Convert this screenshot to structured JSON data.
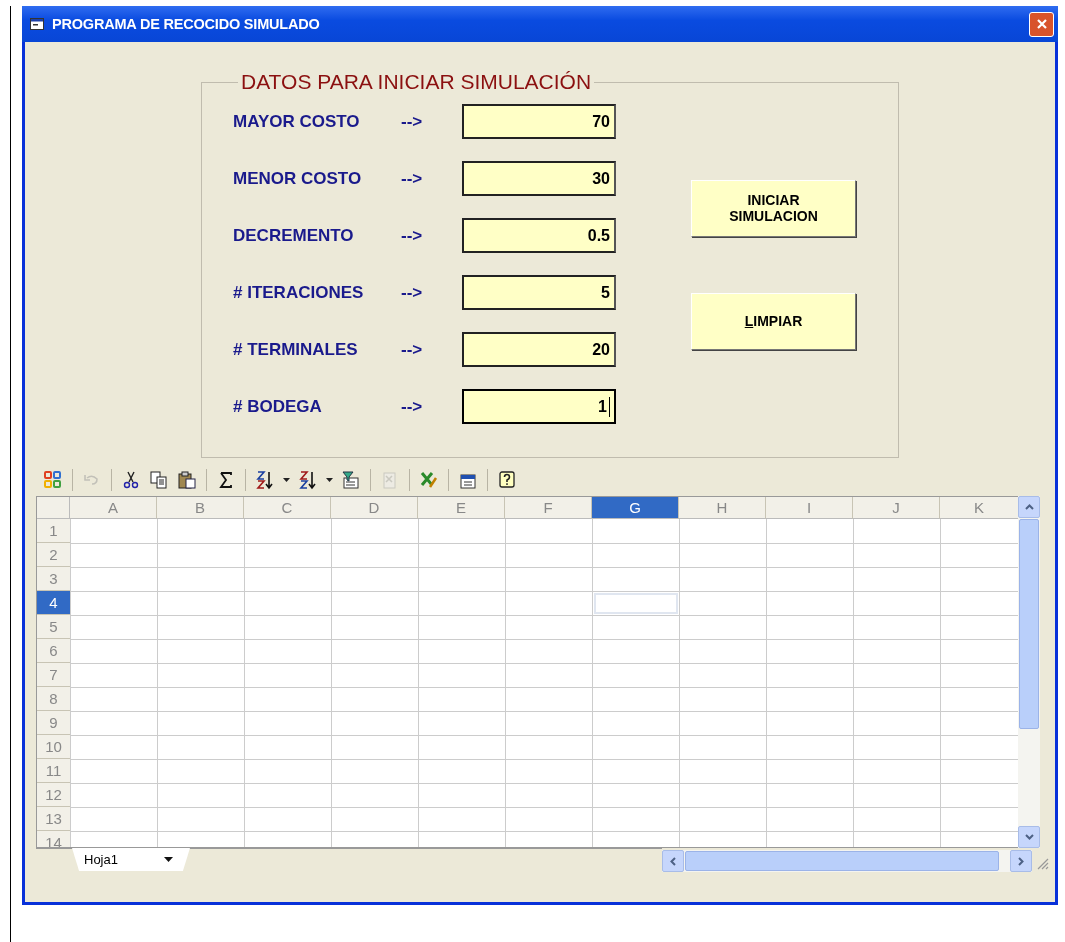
{
  "window": {
    "title": "PROGRAMA DE RECOCIDO SIMULADO"
  },
  "group": {
    "title": "DATOS PARA INICIAR SIMULACIÓN",
    "fields": [
      {
        "label": "MAYOR COSTO",
        "arrow": "-->",
        "value": "70",
        "focused": false
      },
      {
        "label": "MENOR COSTO",
        "arrow": "-->",
        "value": "30",
        "focused": false
      },
      {
        "label": "DECREMENTO",
        "arrow": "-->",
        "value": "0.5",
        "focused": false
      },
      {
        "label": "# ITERACIONES",
        "arrow": "-->",
        "value": "5",
        "focused": false
      },
      {
        "label": "# TERMINALES",
        "arrow": "-->",
        "value": "20",
        "focused": false
      },
      {
        "label": "# BODEGA",
        "arrow": "-->",
        "value": "1",
        "focused": true
      }
    ]
  },
  "buttons": [
    {
      "label": "INICIAR SIMULACION",
      "mnemonic_underlined": false
    },
    {
      "label": "LIMPIAR",
      "mnemonic_underlined": true
    }
  ],
  "toolbar": [
    {
      "kind": "office-logo",
      "disabled": false
    },
    {
      "kind": "separator"
    },
    {
      "kind": "undo",
      "disabled": true
    },
    {
      "kind": "separator"
    },
    {
      "kind": "cut",
      "disabled": false
    },
    {
      "kind": "copy",
      "disabled": false
    },
    {
      "kind": "paste",
      "disabled": false
    },
    {
      "kind": "separator"
    },
    {
      "kind": "sum",
      "disabled": false
    },
    {
      "kind": "separator"
    },
    {
      "kind": "sort-ascending",
      "disabled": false
    },
    {
      "kind": "dropdown"
    },
    {
      "kind": "sort-descending",
      "disabled": false
    },
    {
      "kind": "dropdown"
    },
    {
      "kind": "filter",
      "disabled": false
    },
    {
      "kind": "separator"
    },
    {
      "kind": "properties",
      "disabled": true
    },
    {
      "kind": "separator"
    },
    {
      "kind": "export",
      "disabled": false
    },
    {
      "kind": "separator"
    },
    {
      "kind": "commands",
      "disabled": false
    },
    {
      "kind": "separator"
    },
    {
      "kind": "help",
      "disabled": false
    }
  ],
  "sheet": {
    "columns": [
      {
        "label": "A",
        "selected": false
      },
      {
        "label": "B",
        "selected": false
      },
      {
        "label": "C",
        "selected": false
      },
      {
        "label": "D",
        "selected": false
      },
      {
        "label": "E",
        "selected": false
      },
      {
        "label": "F",
        "selected": false
      },
      {
        "label": "G",
        "selected": true
      },
      {
        "label": "H",
        "selected": false
      },
      {
        "label": "I",
        "selected": false
      },
      {
        "label": "J",
        "selected": false
      },
      {
        "label": "K",
        "selected": false
      }
    ],
    "rows": [
      {
        "label": "1",
        "selected": false
      },
      {
        "label": "2",
        "selected": false
      },
      {
        "label": "3",
        "selected": false
      },
      {
        "label": "4",
        "selected": true
      },
      {
        "label": "5",
        "selected": false
      },
      {
        "label": "6",
        "selected": false
      },
      {
        "label": "7",
        "selected": false
      },
      {
        "label": "8",
        "selected": false
      },
      {
        "label": "9",
        "selected": false
      },
      {
        "label": "10",
        "selected": false
      },
      {
        "label": "11",
        "selected": false
      },
      {
        "label": "12",
        "selected": false
      },
      {
        "label": "13",
        "selected": false
      },
      {
        "label": "14",
        "selected": false
      }
    ],
    "tabs": [
      {
        "label": "Hoja1",
        "selected": true
      }
    ]
  }
}
